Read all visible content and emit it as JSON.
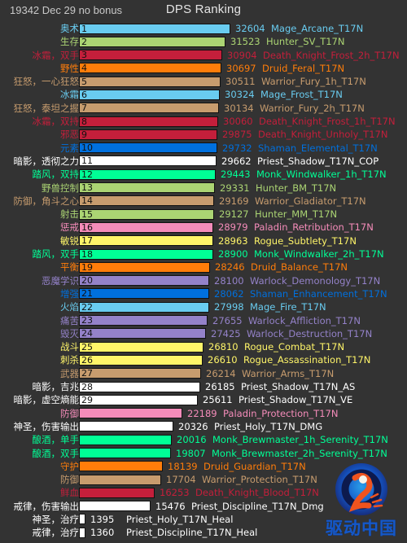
{
  "header": {
    "subtitle": "19342 Dec 29 no bonus",
    "title": "DPS Ranking"
  },
  "logo": {
    "text": "驱动中国",
    "mark_colors": {
      "ring_outer": "#1a3a8f",
      "ring_inner": "#1e7fd0",
      "bird": "#f0531e",
      "accent": "#f5a623"
    }
  },
  "chart_data": {
    "type": "bar",
    "title": "DPS Ranking",
    "subtitle": "19342 Dec 29 no bonus",
    "xlabel": "",
    "ylabel": "",
    "orientation": "horizontal",
    "xlim": [
      0,
      32604
    ],
    "grid": false,
    "legend": "none",
    "categories": [
      "Mage_Arcane_T17N",
      "Hunter_SV_T17N",
      "Death_Knight_Frost_2h_T17N",
      "Druid_Feral_T17N",
      "Warrior_Fury_1h_T17N",
      "Mage_Frost_T17N",
      "Warrior_Fury_2h_T17N",
      "Death_Knight_Frost_1h_T17N",
      "Death_Knight_Unholy_T17N",
      "Shaman_Elemental_T17N",
      "Priest_Shadow_T17N_COP",
      "Monk_Windwalker_1h_T17N",
      "Hunter_BM_T17N",
      "Warrior_Gladiator_T17N",
      "Hunter_MM_T17N",
      "Paladin_Retribution_T17N",
      "Rogue_Subtlety_T17N",
      "Monk_Windwalker_2h_T17N",
      "Druid_Balance_T17N",
      "Warlock_Demonology_T17N",
      "Shaman_Enhancement_T17N",
      "Mage_Fire_T17N",
      "Warlock_Affliction_T17N",
      "Warlock_Destruction_T17N",
      "Rogue_Combat_T17N",
      "Rogue_Assassination_T17N",
      "Warrior_Arms_T17N",
      "Priest_Shadow_T17N_AS",
      "Priest_Shadow_T17N_VE",
      "Paladin_Protection_T17N",
      "Priest_Holy_T17N_DMG",
      "Monk_Brewmaster_1h_Serenity_T17N",
      "Monk_Brewmaster_2h_Serenity_T17N",
      "Druid_Guardian_T17N",
      "Warrior_Protection_T17N",
      "Death_Knight_Blood_T17N",
      "Priest_Discipline_T17N_Dmg",
      "Priest_Holy_T17N_Heal",
      "Priest_Discipline_T17N_Heal"
    ],
    "values": [
      32604,
      31523,
      30904,
      30697,
      30511,
      30324,
      30134,
      30060,
      29875,
      29732,
      29662,
      29443,
      29331,
      29169,
      29127,
      28979,
      28963,
      28900,
      28246,
      28100,
      28062,
      27998,
      27655,
      27425,
      26810,
      26610,
      26214,
      26185,
      25611,
      22189,
      20326,
      20016,
      19807,
      18139,
      17704,
      16253,
      15476,
      1395,
      1360
    ]
  },
  "rows": [
    {
      "rank": "1",
      "label": "奥术",
      "value": "32604",
      "name": "Mage_Arcane_T17N",
      "v": 32604,
      "color": "#69ccf0"
    },
    {
      "rank": "2",
      "label": "生存",
      "value": "31523",
      "name": "Hunter_SV_T17N",
      "v": 31523,
      "color": "#abd473"
    },
    {
      "rank": "3",
      "label": "冰霜，双手",
      "value": "30904",
      "name": "Death_Knight_Frost_2h_T17N",
      "v": 30904,
      "color": "#c41f3b"
    },
    {
      "rank": "4",
      "label": "野性",
      "value": "30697",
      "name": "Druid_Feral_T17N",
      "v": 30697,
      "color": "#ff7d0a"
    },
    {
      "rank": "5",
      "label": "狂怒，一心狂怒",
      "value": "30511",
      "name": "Warrior_Fury_1h_T17N",
      "v": 30511,
      "color": "#c79c6e"
    },
    {
      "rank": "6",
      "label": "冰霜",
      "value": "30324",
      "name": "Mage_Frost_T17N",
      "v": 30324,
      "color": "#69ccf0"
    },
    {
      "rank": "7",
      "label": "狂怒，泰坦之握",
      "value": "30134",
      "name": "Warrior_Fury_2h_T17N",
      "v": 30134,
      "color": "#c79c6e"
    },
    {
      "rank": "8",
      "label": "冰霜，双持",
      "value": "30060",
      "name": "Death_Knight_Frost_1h_T17N",
      "v": 30060,
      "color": "#c41f3b"
    },
    {
      "rank": "9",
      "label": "邪恶",
      "value": "29875",
      "name": "Death_Knight_Unholy_T17N",
      "v": 29875,
      "color": "#c41f3b"
    },
    {
      "rank": "10",
      "label": "元素",
      "value": "29732",
      "name": "Shaman_Elemental_T17N",
      "v": 29732,
      "color": "#0070de"
    },
    {
      "rank": "11",
      "label": "暗影，透彻之力",
      "value": "29662",
      "name": "Priest_Shadow_T17N_COP",
      "v": 29662,
      "color": "#ffffff"
    },
    {
      "rank": "12",
      "label": "踏风，双持",
      "value": "29443",
      "name": "Monk_Windwalker_1h_T17N",
      "v": 29443,
      "color": "#00ff96"
    },
    {
      "rank": "13",
      "label": "野兽控制",
      "value": "29331",
      "name": "Hunter_BM_T17N",
      "v": 29331,
      "color": "#abd473"
    },
    {
      "rank": "14",
      "label": "防御，角斗之心",
      "value": "29169",
      "name": "Warrior_Gladiator_T17N",
      "v": 29169,
      "color": "#c79c6e"
    },
    {
      "rank": "15",
      "label": "射击",
      "value": "29127",
      "name": "Hunter_MM_T17N",
      "v": 29127,
      "color": "#abd473"
    },
    {
      "rank": "16",
      "label": "惩戒",
      "value": "28979",
      "name": "Paladin_Retribution_T17N",
      "v": 28979,
      "color": "#f58cba"
    },
    {
      "rank": "17",
      "label": "敏锐",
      "value": "28963",
      "name": "Rogue_Subtlety_T17N",
      "v": 28963,
      "color": "#fff569"
    },
    {
      "rank": "18",
      "label": "踏风，双手",
      "value": "28900",
      "name": "Monk_Windwalker_2h_T17N",
      "v": 28900,
      "color": "#00ff96"
    },
    {
      "rank": "19",
      "label": "平衡",
      "value": "28246",
      "name": "Druid_Balance_T17N",
      "v": 28246,
      "color": "#ff7d0a"
    },
    {
      "rank": "20",
      "label": "恶魔学识",
      "value": "28100",
      "name": "Warlock_Demonology_T17N",
      "v": 28100,
      "color": "#9482c9"
    },
    {
      "rank": "21",
      "label": "增强",
      "value": "28062",
      "name": "Shaman_Enhancement_T17N",
      "v": 28062,
      "color": "#0070de"
    },
    {
      "rank": "22",
      "label": "火焰",
      "value": "27998",
      "name": "Mage_Fire_T17N",
      "v": 27998,
      "color": "#69ccf0"
    },
    {
      "rank": "23",
      "label": "痛苦",
      "value": "27655",
      "name": "Warlock_Affliction_T17N",
      "v": 27655,
      "color": "#9482c9"
    },
    {
      "rank": "24",
      "label": "毁灭",
      "value": "27425",
      "name": "Warlock_Destruction_T17N",
      "v": 27425,
      "color": "#9482c9"
    },
    {
      "rank": "25",
      "label": "战斗",
      "value": "26810",
      "name": "Rogue_Combat_T17N",
      "v": 26810,
      "color": "#fff569"
    },
    {
      "rank": "26",
      "label": "刺杀",
      "value": "26610",
      "name": "Rogue_Assassination_T17N",
      "v": 26610,
      "color": "#fff569"
    },
    {
      "rank": "27",
      "label": "武器",
      "value": "26214",
      "name": "Warrior_Arms_T17N",
      "v": 26214,
      "color": "#c79c6e"
    },
    {
      "rank": "28",
      "label": "暗影，吉兆",
      "value": "26185",
      "name": "Priest_Shadow_T17N_AS",
      "v": 26185,
      "color": "#ffffff"
    },
    {
      "rank": "29",
      "label": "暗影，虚空熵能",
      "value": "25611",
      "name": "Priest_Shadow_T17N_VE",
      "v": 25611,
      "color": "#ffffff"
    },
    {
      "rank": "",
      "label": "防御",
      "value": "22189",
      "name": "Paladin_Protection_T17N",
      "v": 22189,
      "color": "#f58cba"
    },
    {
      "rank": "",
      "label": "神圣，伤害输出",
      "value": "20326",
      "name": "Priest_Holy_T17N_DMG",
      "v": 20326,
      "color": "#ffffff"
    },
    {
      "rank": "",
      "label": "酿酒，单手",
      "value": "20016",
      "name": "Monk_Brewmaster_1h_Serenity_T17N",
      "v": 20016,
      "color": "#00ff96"
    },
    {
      "rank": "",
      "label": "酿酒，双手",
      "value": "19807",
      "name": "Monk_Brewmaster_2h_Serenity_T17N",
      "v": 19807,
      "color": "#00ff96"
    },
    {
      "rank": "",
      "label": "守护",
      "value": "18139",
      "name": "Druid_Guardian_T17N",
      "v": 18139,
      "color": "#ff7d0a"
    },
    {
      "rank": "",
      "label": "防御",
      "value": "17704",
      "name": "Warrior_Protection_T17N",
      "v": 17704,
      "color": "#c79c6e"
    },
    {
      "rank": "",
      "label": "鲜血",
      "value": "16253",
      "name": "Death_Knight_Blood_T17N",
      "v": 16253,
      "color": "#c41f3b"
    },
    {
      "rank": "",
      "label": "戒律，伤害输出",
      "value": "15476",
      "name": "Priest_Discipline_T17N_Dmg",
      "v": 15476,
      "color": "#ffffff"
    },
    {
      "rank": "",
      "label": "神圣，治疗",
      "value": "1395",
      "name": "Priest_Holy_T17N_Heal",
      "v": 1395,
      "color": "#ffffff"
    },
    {
      "rank": "",
      "label": "戒律，治疗",
      "value": "1360",
      "name": "Priest_Discipline_T17N_Heal",
      "v": 1360,
      "color": "#ffffff"
    }
  ]
}
